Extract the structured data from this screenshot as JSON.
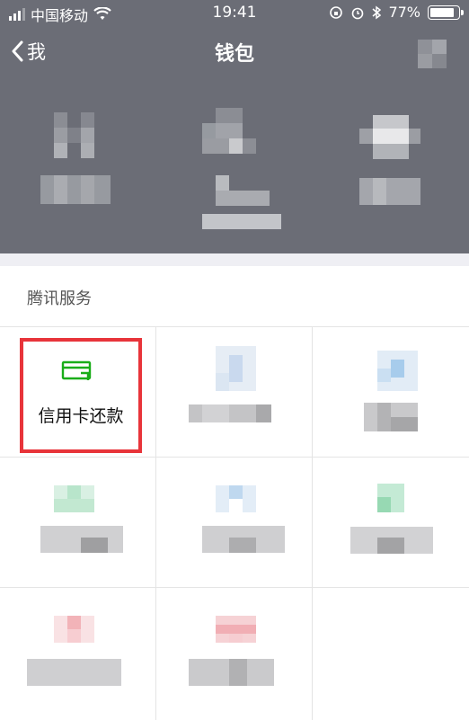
{
  "status_bar": {
    "carrier": "中国移动",
    "time": "19:41",
    "battery": "77%",
    "battery_level": 0.77
  },
  "nav": {
    "back_label": "我",
    "title": "钱包"
  },
  "section": {
    "title": "腾讯服务"
  },
  "services": [
    {
      "label": "信用卡还款",
      "icon": "credit-card-repay-icon",
      "color": "#1aad19"
    }
  ],
  "colors": {
    "header_bg": "#6b6d76",
    "highlight": "#e8343a",
    "icon_green": "#1aad19"
  }
}
